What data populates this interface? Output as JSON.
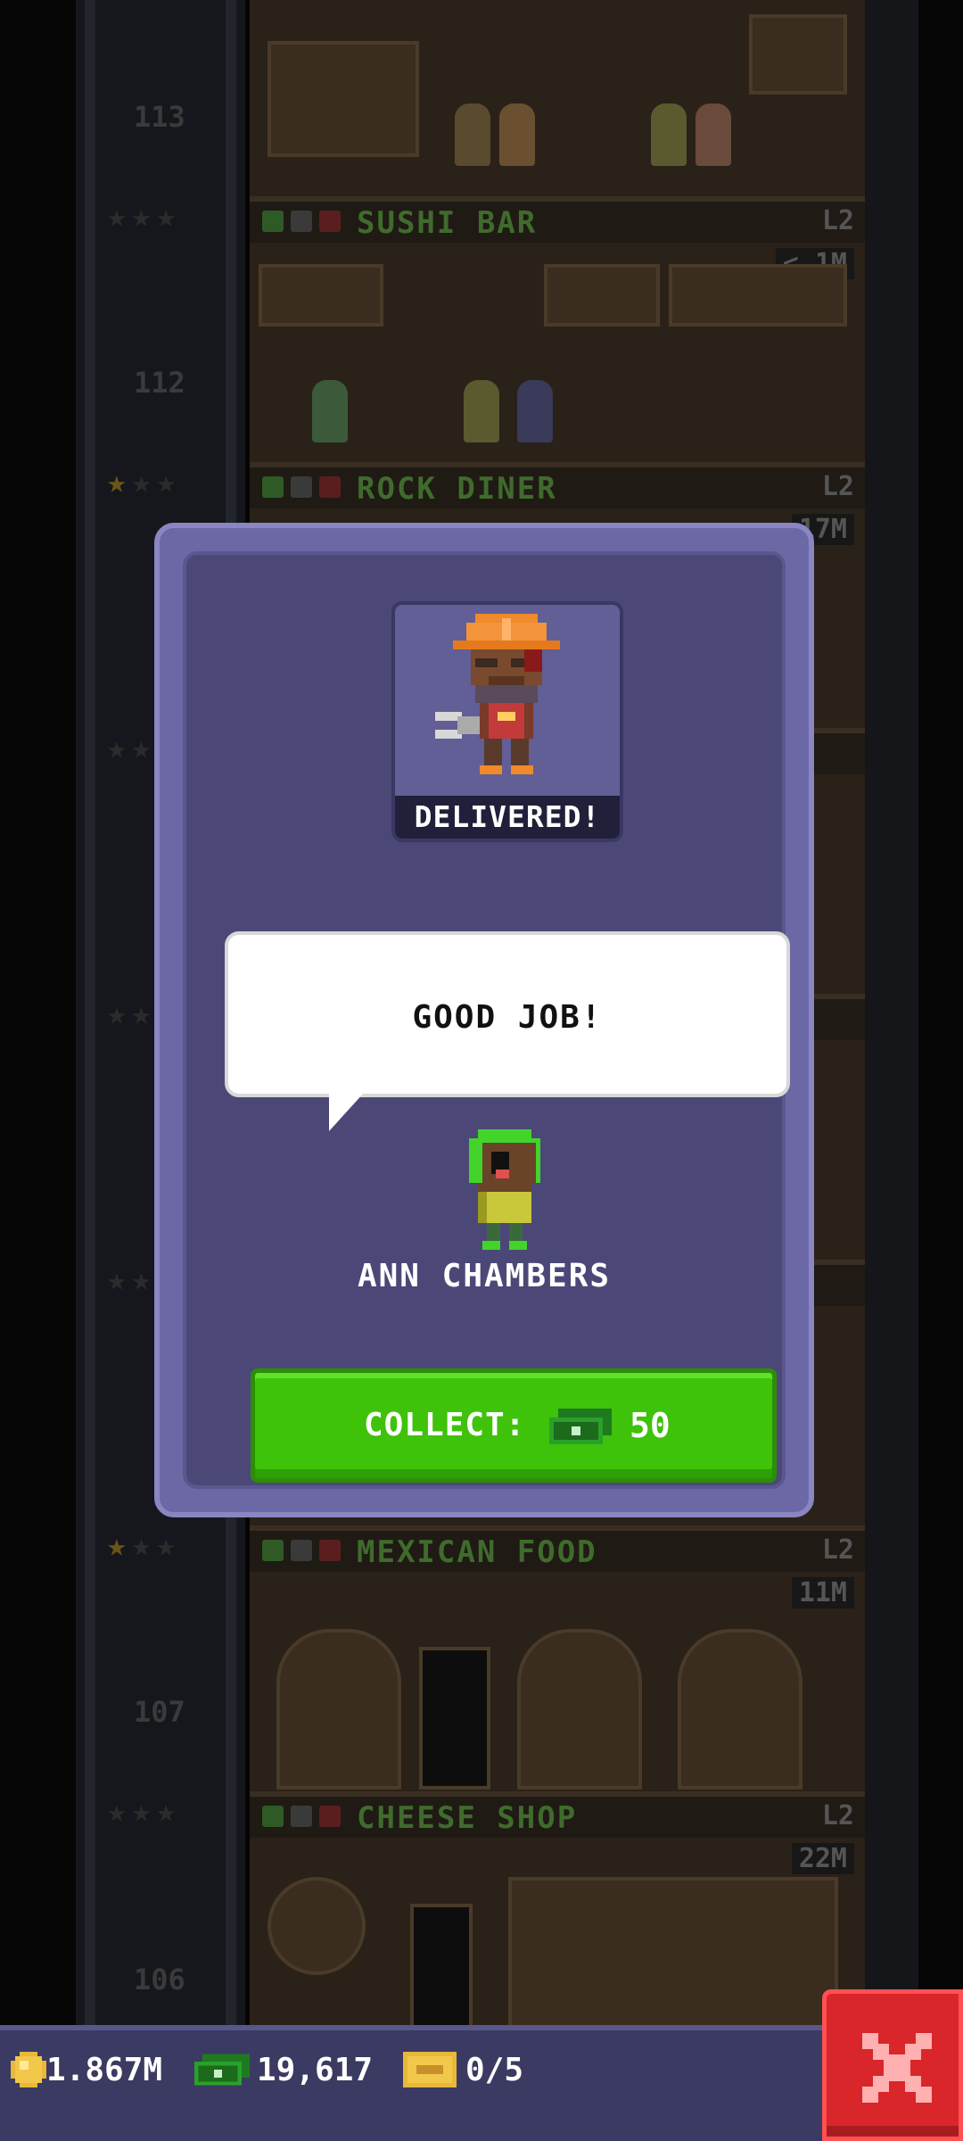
{
  "tower": {
    "floors": [
      {
        "name": "SUSHI BAR",
        "level": "L2",
        "price": "< 1M",
        "number": "112",
        "stars_lit": 0
      },
      {
        "name": "ROCK DINER",
        "level": "L2",
        "price": "17M",
        "number": "",
        "stars_lit": 1
      },
      {
        "name": "MEXICAN FOOD",
        "level": "L2",
        "price": "11M",
        "number": "107",
        "stars_lit": 1
      },
      {
        "name": "CHEESE SHOP",
        "level": "L2",
        "price": "22M",
        "number": "106",
        "stars_lit": 0
      }
    ],
    "top_floor_number": "113"
  },
  "modal": {
    "status": "DELIVERED!",
    "message": "GOOD JOB!",
    "customer_name": "ANN CHAMBERS",
    "collect_label": "COLLECT:",
    "collect_amount": "50",
    "portrait_icon": "construction-worker-icon",
    "customer_icon": "green-hood-customer-icon"
  },
  "hud": {
    "coins": "1.867M",
    "bux": "19,617",
    "tickets": "0/5",
    "coin_icon": "coin-icon",
    "bux_icon": "bux-bill-icon",
    "ticket_icon": "ticket-icon",
    "close_icon": "close-icon"
  },
  "colors": {
    "modal_frame": "#6c68a6",
    "modal_bg": "#4b4878",
    "collect_green": "#3ec20a",
    "close_red": "#d8262a",
    "hud_bg": "#3a3a62"
  }
}
